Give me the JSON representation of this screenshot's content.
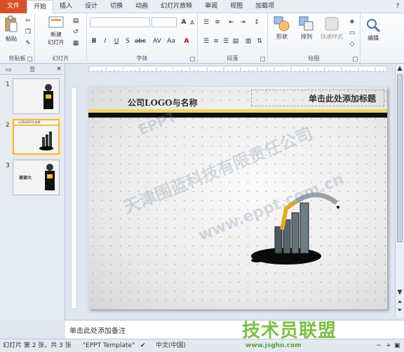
{
  "tabs": [
    "文件",
    "开始",
    "插入",
    "设计",
    "切换",
    "动画",
    "幻灯片放映",
    "审阅",
    "视图",
    "加载项"
  ],
  "ribbon": {
    "paste": "粘贴",
    "clipboard": "剪贴板",
    "new_slide_1": "新建",
    "new_slide_2": "幻灯片",
    "slides": "幻灯片",
    "font": "字体",
    "paragraph": "段落",
    "shapes": "形状",
    "arrange": "排列",
    "quick_styles": "快速样式",
    "drawing": "绘图",
    "edit": "编辑",
    "font_size_a": "A",
    "bold": "B",
    "italic": "I",
    "underline": "U",
    "strike": "S",
    "abc": "abc",
    "av": "AV",
    "aa": "Aa"
  },
  "slide": {
    "logo_text": "公司LOGO与名称",
    "title_placeholder": "单击此处添加标题"
  },
  "thumbs": [
    {
      "num": "1"
    },
    {
      "num": "2",
      "mini_text": "公司LOGO与名称"
    },
    {
      "num": "3",
      "mini_text": "谢谢大"
    }
  ],
  "notes": {
    "placeholder": "单击此处添加备注"
  },
  "status": {
    "slide_info": "幻灯片 第 2 张，共 3 张",
    "theme": "\"EPPT Template\"",
    "language": "中文(中国)"
  },
  "watermarks": {
    "w1": "天津围蓝科技有限责任公司",
    "w2": "www.eppt.com.cn",
    "w3": "EPPT",
    "brand": "技术员联盟",
    "brand_url": "www.jsgho.com"
  },
  "colors": {
    "file_tab": "#d8502a",
    "highlight": "#f3b64a",
    "brand": "#7ac142"
  }
}
